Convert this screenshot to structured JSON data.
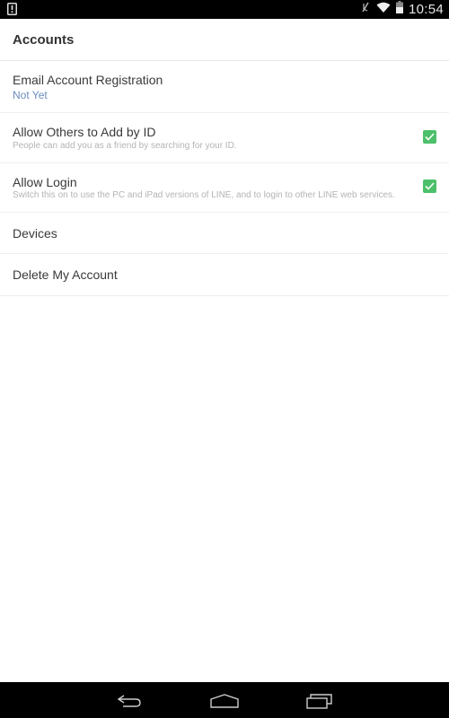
{
  "status_bar": {
    "left_icon": "alert-notification-icon",
    "icons": [
      "mute-icon",
      "wifi-icon",
      "battery-icon"
    ],
    "time": "10:54"
  },
  "header": {
    "title": "Accounts"
  },
  "settings": {
    "email": {
      "title": "Email Account Registration",
      "value": "Not Yet"
    },
    "add_by_id": {
      "title": "Allow Others to Add by ID",
      "description": "People can add you as a friend by searching for your ID.",
      "checked": true
    },
    "allow_login": {
      "title": "Allow Login",
      "description": "Switch this on to use the PC and iPad versions of LINE, and to login to other LINE web services.",
      "checked": true
    },
    "devices": {
      "title": "Devices"
    },
    "delete_account": {
      "title": "Delete My Account"
    }
  },
  "colors": {
    "accent_check": "#4cc06a",
    "link_value": "#6b8cbc"
  },
  "nav_bar": {
    "buttons": [
      "back-icon",
      "home-icon",
      "recent-apps-icon"
    ]
  }
}
